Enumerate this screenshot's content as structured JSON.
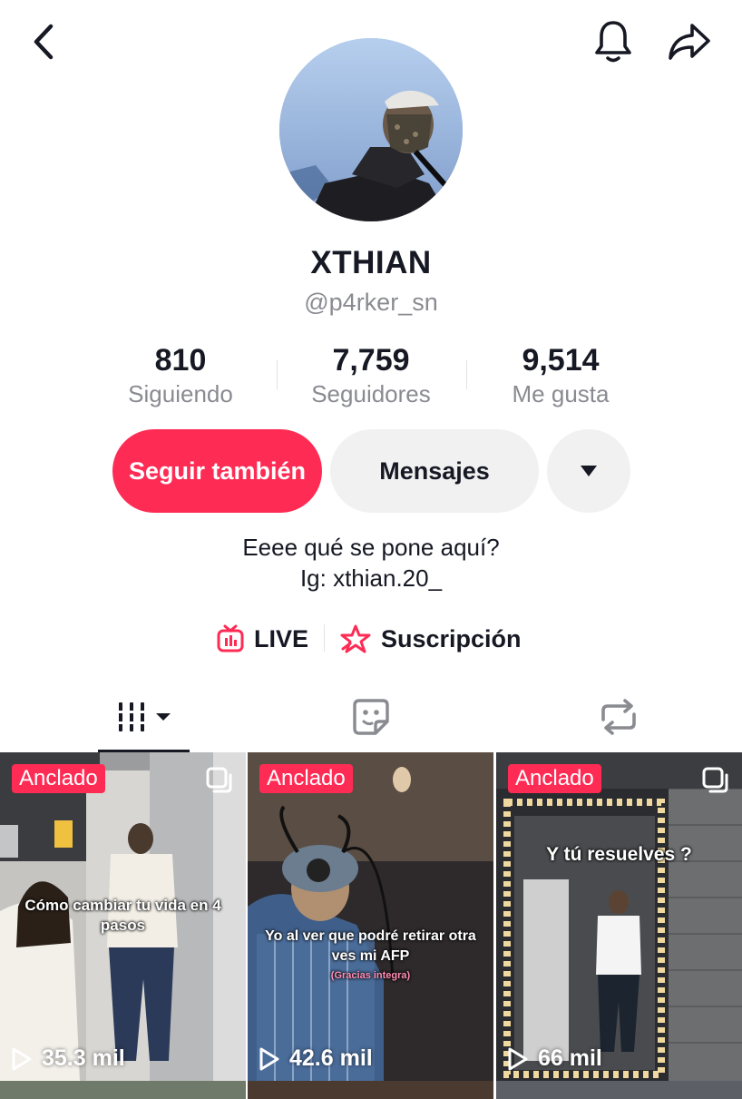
{
  "profile": {
    "display_name": "XTHIAN",
    "handle": "@p4rker_sn",
    "bio_line1": "Eeee qué se pone aquí?",
    "bio_line2": "Ig: xthian.20_"
  },
  "stats": [
    {
      "value": "810",
      "label": "Siguiendo"
    },
    {
      "value": "7,759",
      "label": "Seguidores"
    },
    {
      "value": "9,514",
      "label": "Me gusta"
    }
  ],
  "actions": {
    "follow_back": "Seguir también",
    "messages": "Mensajes"
  },
  "links": {
    "live": "LIVE",
    "subscription": "Suscripción"
  },
  "videos": [
    {
      "badge": "Anclado",
      "caption": "Cómo cambiar tu vida en 4 pasos",
      "views": "35.3 mil"
    },
    {
      "badge": "Anclado",
      "caption": "Yo al ver que podré retirar otra ves mi AFP",
      "subcaption": "(Gracias integra)",
      "views": "42.6 mil"
    },
    {
      "badge": "Anclado",
      "caption": "Y tú resuelves ?",
      "views": "66 mil"
    }
  ],
  "colors": {
    "accent": "#fe2c55",
    "secondary_bg": "#f1f1f2",
    "muted_text": "#8a8b91"
  },
  "icons": [
    "back-icon",
    "bell-icon",
    "share-icon",
    "caret-down-icon",
    "live-tv-icon",
    "subscription-star-icon",
    "grid-videos-icon",
    "sticker-icon",
    "repost-icon",
    "multi-image-icon",
    "play-icon"
  ]
}
